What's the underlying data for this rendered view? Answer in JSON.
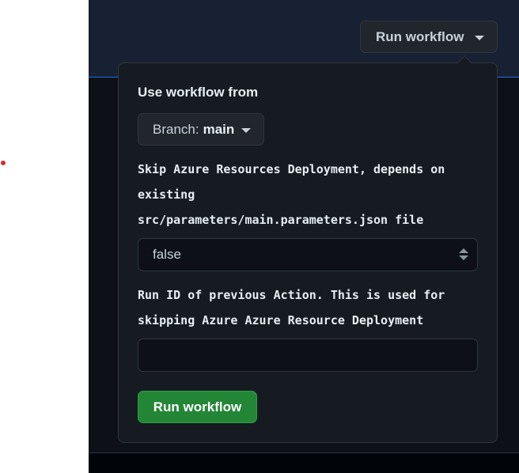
{
  "header": {
    "run_workflow_label": "Run workflow"
  },
  "dropdown": {
    "use_workflow_from_label": "Use workflow from",
    "branch": {
      "prefix": "Branch:",
      "value": "main"
    },
    "inputs": [
      {
        "label_lines": [
          "Skip Azure Resources Deployment, depends on",
          "existing",
          "src/parameters/main.parameters.json file"
        ],
        "value": "false",
        "type": "select"
      },
      {
        "label_lines": [
          "Run ID of previous Action. This is used for",
          "skipping Azure Azure Resource Deployment"
        ],
        "value": "",
        "type": "text"
      }
    ],
    "submit_label": "Run workflow"
  },
  "colors": {
    "panel_bg": "#161b22",
    "page_dark_bg": "#0d1117",
    "header_bg": "#172133",
    "accent_green": "#238636",
    "border": "#30363d"
  }
}
